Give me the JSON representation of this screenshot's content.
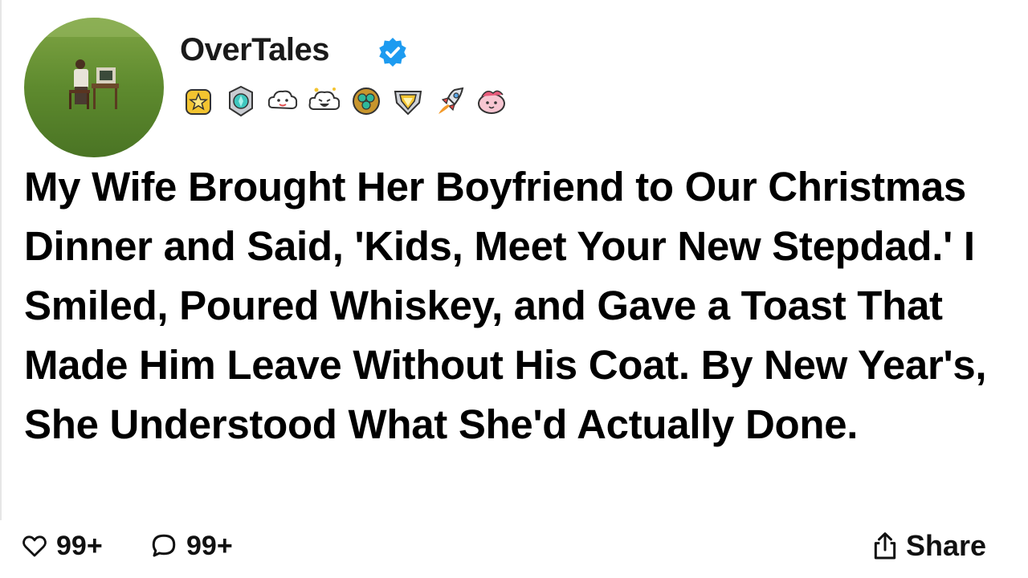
{
  "post": {
    "author": {
      "name": "OverTales",
      "verified": true,
      "avatar_icon": "man-at-retro-computer-in-field",
      "badges": [
        {
          "name": "gold-star-badge-icon"
        },
        {
          "name": "teal-gem-badge-icon"
        },
        {
          "name": "cloud-face-badge-icon"
        },
        {
          "name": "laughing-cloud-badge-icon"
        },
        {
          "name": "emerald-clover-badge-icon"
        },
        {
          "name": "diamond-shield-badge-icon"
        },
        {
          "name": "rocket-badge-icon"
        },
        {
          "name": "pink-creature-badge-icon"
        }
      ]
    },
    "title": "My Wife Brought Her Boyfriend to Our Christmas Dinner and Said, 'Kids, Meet Your New Stepdad.' I Smiled, Poured Whiskey, and Gave a Toast That Made Him Leave Without His Coat. By New Year's, She Understood What She'd Actually Done.",
    "actions": {
      "likes": "99+",
      "comments": "99+",
      "share_label": "Share"
    }
  },
  "colors": {
    "verified": "#1d9bf0",
    "text": "#000000",
    "grass": "#5e8a2e"
  }
}
